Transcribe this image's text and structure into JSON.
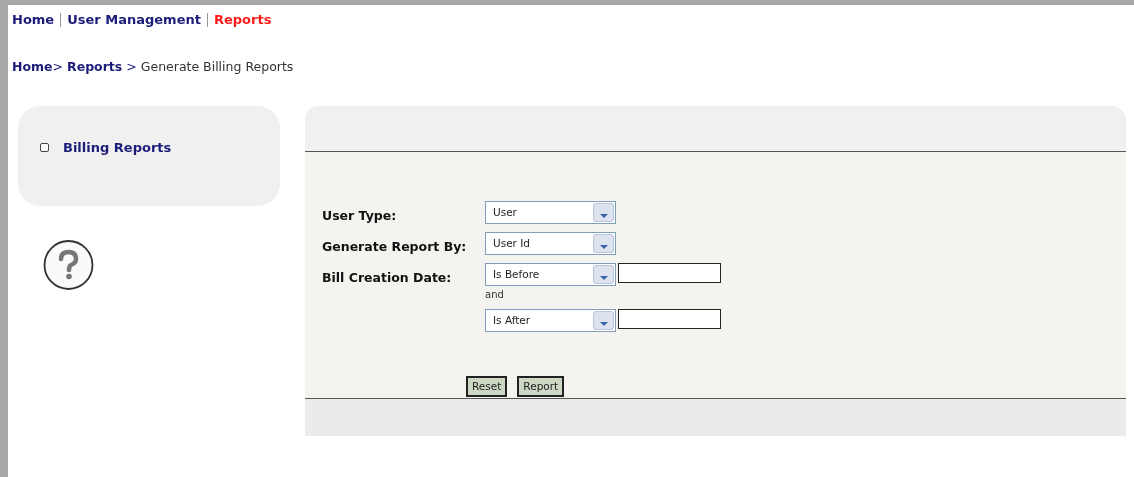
{
  "nav": [
    {
      "label": "Home",
      "selected": false
    },
    {
      "label": "User Management",
      "selected": false
    },
    {
      "label": "Reports",
      "selected": true
    }
  ],
  "breadcrumb": [
    {
      "label": "Home",
      "kind": "link"
    },
    {
      "label": ">",
      "kind": "separator"
    },
    {
      "label": "Reports",
      "kind": "link"
    },
    {
      "label": ">",
      "kind": "separator"
    },
    {
      "label": "Generate Billing Reports",
      "kind": "current"
    }
  ],
  "sidebar": {
    "items": [
      {
        "label": "Billing Reports",
        "checked": false
      }
    ]
  },
  "form": {
    "rows": [
      {
        "kind": "select",
        "label": "User Type:",
        "value": "User"
      },
      {
        "kind": "select",
        "label": "Generate Report By:",
        "value": "User Id"
      },
      {
        "kind": "select_with_input",
        "label": "Bill Creation Date:",
        "value": "Is Before"
      },
      {
        "kind": "note",
        "text": "and"
      },
      {
        "kind": "select_with_input",
        "value": "Is After"
      }
    ],
    "buttons": [
      "Reset",
      "Report"
    ]
  }
}
